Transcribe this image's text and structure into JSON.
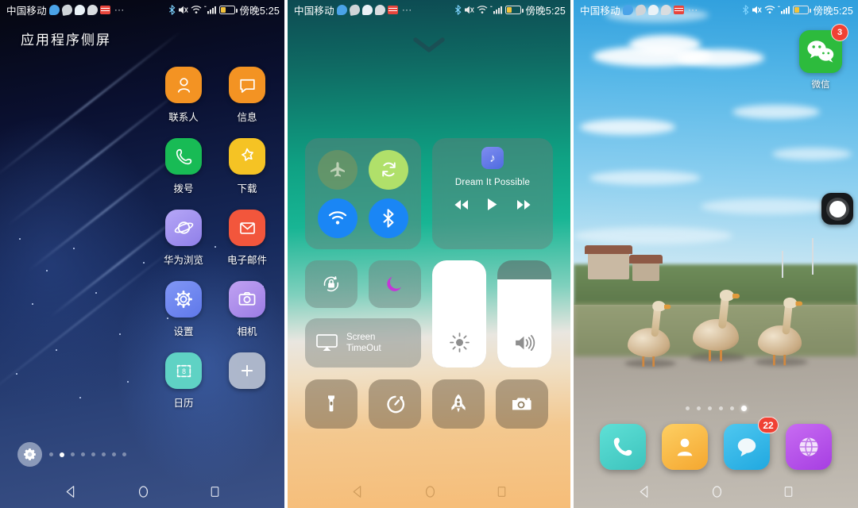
{
  "status_bar": {
    "carrier": "中国移动",
    "time": "傍晚5:25",
    "overflow": "···",
    "icons": [
      "qq-icon",
      "wechat-icon",
      "qq-alt-icon",
      "message-icon",
      "news-icon"
    ],
    "right_icons": [
      "bluetooth-icon",
      "mute-icon",
      "wifi-icon",
      "signal-icon",
      "battery-icon"
    ]
  },
  "panel_apps": {
    "title": "应用程序侧屏",
    "apps": [
      {
        "label": "联系人",
        "icon": "contacts-icon",
        "color": "#f39323"
      },
      {
        "label": "信息",
        "icon": "messages-icon",
        "color": "#f39323"
      },
      {
        "label": "拨号",
        "icon": "dialer-icon",
        "color": "#18bb55"
      },
      {
        "label": "下载",
        "icon": "downloads-icon",
        "color": "#f5c324"
      },
      {
        "label": "华为浏览",
        "icon": "browser-icon",
        "color": "#9a8df0"
      },
      {
        "label": "电子邮件",
        "icon": "email-icon",
        "color": "#f2563c"
      },
      {
        "label": "设置",
        "icon": "settings-icon",
        "color": "#6b83ef"
      },
      {
        "label": "相机",
        "icon": "camera-icon",
        "color": "#a98ae8"
      },
      {
        "label": "日历",
        "icon": "calendar-icon",
        "color": "#5fd2c4"
      },
      {
        "label": "",
        "icon": "add-icon",
        "color": "#b9bfc9"
      }
    ],
    "calendar_day": "8",
    "pager": {
      "gear_icon": "gear-icon",
      "count": 8,
      "active_index": 1
    }
  },
  "panel_control": {
    "chevron_icon": "chevron-down-icon",
    "toggles": [
      {
        "name": "airplane-mode-toggle",
        "icon": "airplane-icon",
        "state": "off"
      },
      {
        "name": "rotation-lock-toggle",
        "icon": "rotate-icon",
        "state": "on"
      },
      {
        "name": "wifi-toggle",
        "icon": "wifi-icon",
        "state": "on"
      },
      {
        "name": "bluetooth-toggle",
        "icon": "bluetooth-icon",
        "state": "on"
      }
    ],
    "media": {
      "app_icon": "music-note-icon",
      "title": "Dream It Possible",
      "controls": [
        "previous-icon",
        "play-icon",
        "next-icon"
      ]
    },
    "tiles": [
      {
        "name": "orientation-lock-tile",
        "icon": "lock-rotate-icon"
      },
      {
        "name": "do-not-disturb-tile",
        "icon": "moon-icon"
      }
    ],
    "cast": {
      "label": "Screen\nTimeOut",
      "line1": "Screen",
      "line2": "TimeOut",
      "icon": "airplay-icon"
    },
    "sliders": [
      {
        "name": "brightness-slider",
        "icon": "brightness-icon",
        "value": 100
      },
      {
        "name": "volume-slider",
        "icon": "volume-icon",
        "value": 82
      }
    ],
    "shortcuts": [
      {
        "name": "flashlight-shortcut",
        "icon": "flashlight-icon"
      },
      {
        "name": "timer-shortcut",
        "icon": "timer-icon"
      },
      {
        "name": "boost-shortcut",
        "icon": "rocket-icon"
      },
      {
        "name": "camera-shortcut",
        "icon": "camera-icon"
      }
    ]
  },
  "panel_home": {
    "wechat": {
      "label": "微信",
      "badge": "3",
      "icon": "wechat-icon"
    },
    "assistive_touch": {
      "name": "assistive-touch-button",
      "icon": "circle-icon"
    },
    "page_dots": {
      "count": 6,
      "active_index": 5
    },
    "dock": [
      {
        "name": "phone",
        "icon": "phone-icon",
        "color": "#4bd5ce",
        "badge": ""
      },
      {
        "name": "contacts",
        "icon": "contacts-icon",
        "color": "#f9b940",
        "badge": ""
      },
      {
        "name": "messages",
        "icon": "messages-icon",
        "color": "#31b7e8",
        "badge": "22"
      },
      {
        "name": "browser",
        "icon": "browser-icon",
        "color": "#b455e8",
        "badge": ""
      }
    ]
  },
  "nav_bar": {
    "back": "back-icon",
    "home": "home-icon",
    "recents": "recents-icon"
  },
  "colors": {
    "accent_orange": "#f39323",
    "accent_green": "#18bb55",
    "accent_blue": "#1a86f5",
    "badge_red": "#f04134",
    "wechat_green": "#2dbb3d"
  }
}
